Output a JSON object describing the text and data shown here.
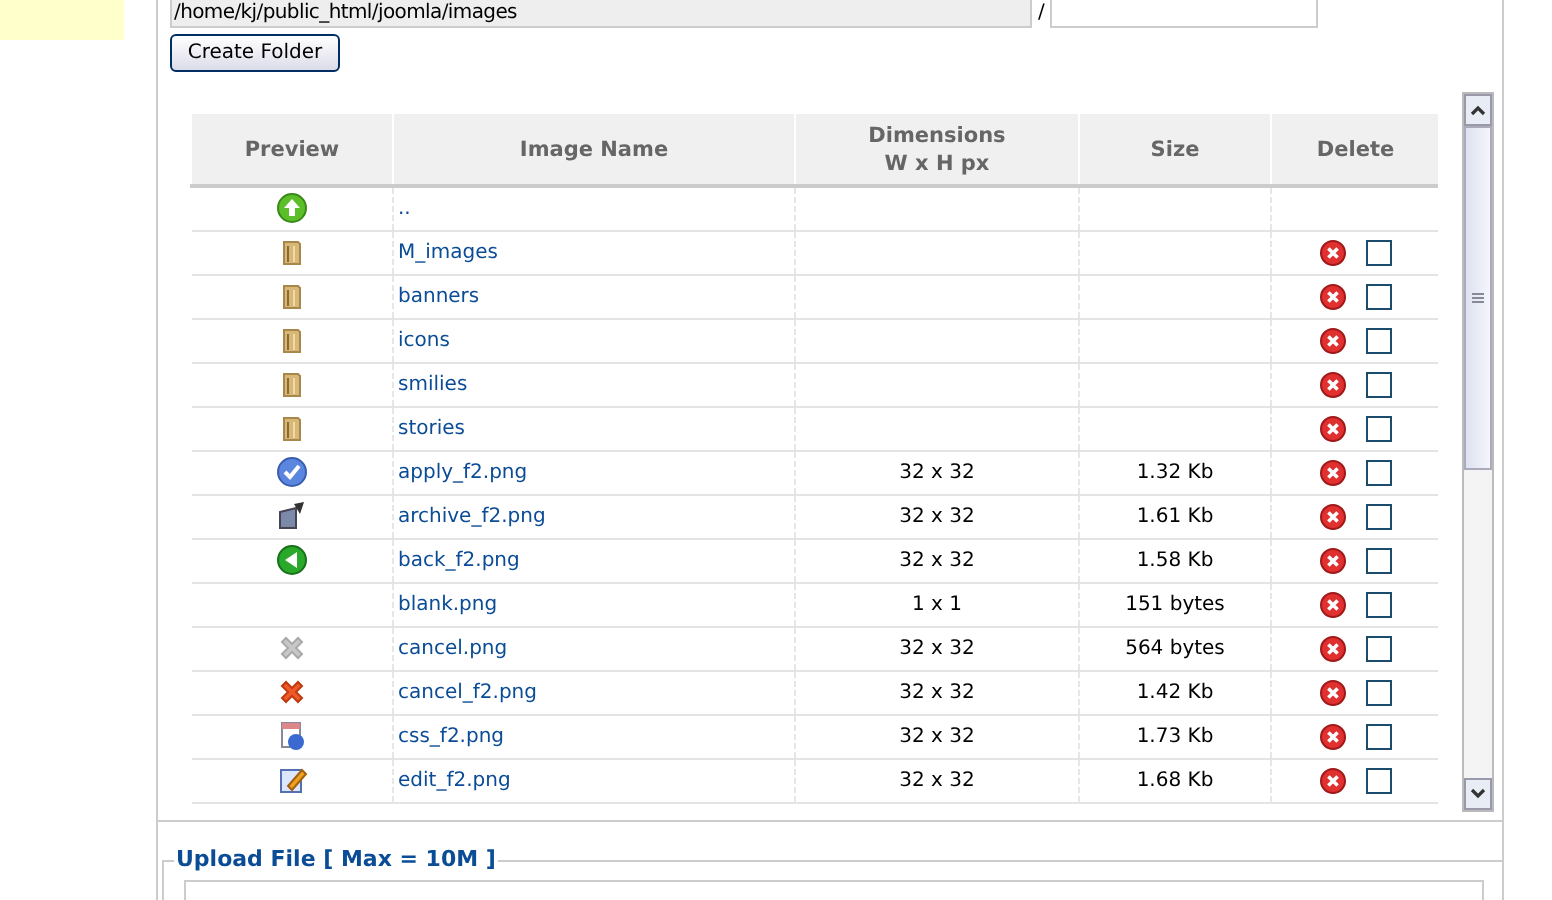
{
  "path_field": {
    "value": "/home/kj/public_html/joomla/images"
  },
  "path_separator": "/",
  "create_folder_button": "Create Folder",
  "table": {
    "columns": [
      "Preview",
      "Image Name",
      "Dimensions\nW x H px",
      "Size",
      "Delete"
    ],
    "rows": [
      {
        "kind": "up",
        "name": "..",
        "dimensions": "",
        "size": ""
      },
      {
        "kind": "folder",
        "name": "M_images",
        "dimensions": "",
        "size": "",
        "checked": false
      },
      {
        "kind": "folder",
        "name": "banners",
        "dimensions": "",
        "size": "",
        "checked": false
      },
      {
        "kind": "folder",
        "name": "icons",
        "dimensions": "",
        "size": "",
        "checked": false
      },
      {
        "kind": "folder",
        "name": "smilies",
        "dimensions": "",
        "size": "",
        "checked": false
      },
      {
        "kind": "folder",
        "name": "stories",
        "dimensions": "",
        "size": "",
        "checked": false
      },
      {
        "kind": "apply",
        "name": "apply_f2.png",
        "dimensions": "32 x 32",
        "size": "1.32 Kb",
        "checked": false
      },
      {
        "kind": "archive",
        "name": "archive_f2.png",
        "dimensions": "32 x 32",
        "size": "1.61 Kb",
        "checked": false
      },
      {
        "kind": "back",
        "name": "back_f2.png",
        "dimensions": "32 x 32",
        "size": "1.58 Kb",
        "checked": false
      },
      {
        "kind": "none",
        "name": "blank.png",
        "dimensions": "1 x 1",
        "size": "151 bytes",
        "checked": false
      },
      {
        "kind": "cancel-grey",
        "name": "cancel.png",
        "dimensions": "32 x 32",
        "size": "564 bytes",
        "checked": false
      },
      {
        "kind": "cancel",
        "name": "cancel_f2.png",
        "dimensions": "32 x 32",
        "size": "1.42 Kb",
        "checked": false
      },
      {
        "kind": "css",
        "name": "css_f2.png",
        "dimensions": "32 x 32",
        "size": "1.73 Kb",
        "checked": false
      },
      {
        "kind": "edit",
        "name": "edit_f2.png",
        "dimensions": "32 x 32",
        "size": "1.68 Kb",
        "checked": false
      }
    ]
  },
  "upload_legend": "Upload File [ Max = 10M ]"
}
